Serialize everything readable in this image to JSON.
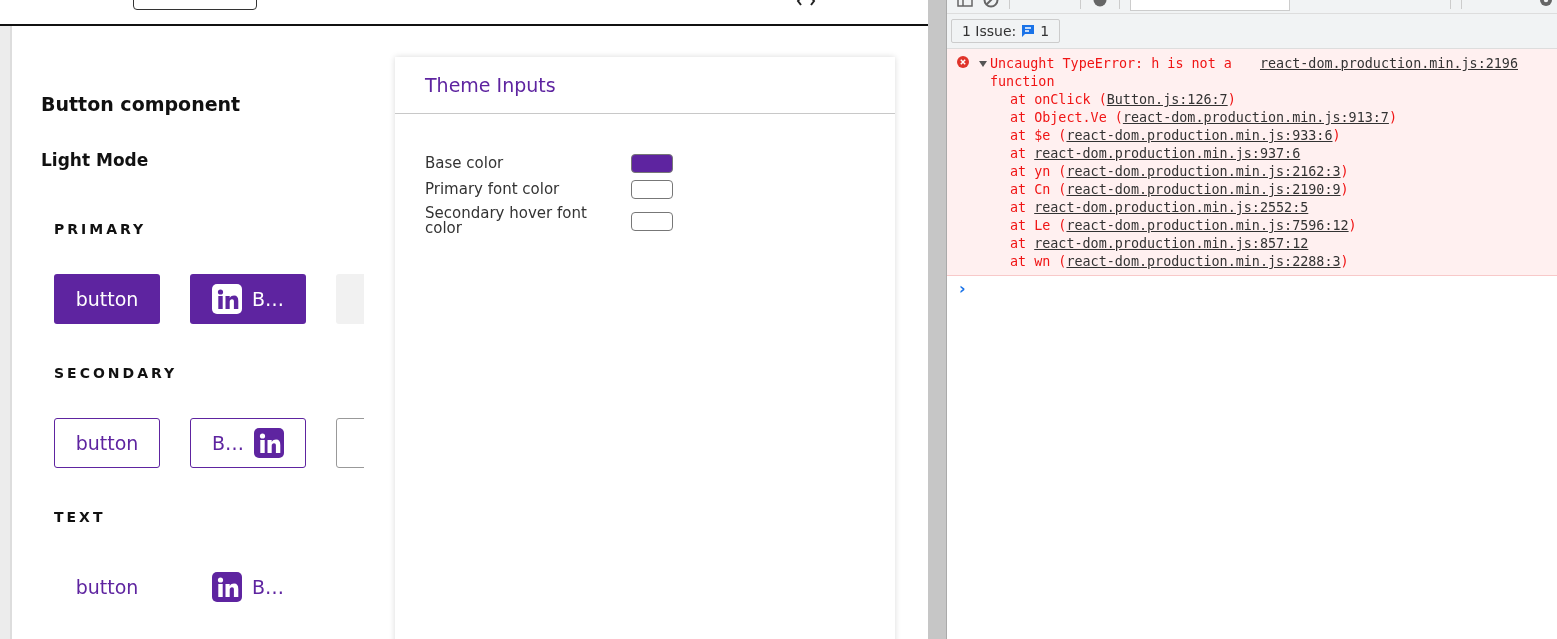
{
  "page": {
    "heading": "Button component",
    "mode": "Light Mode",
    "sections": [
      {
        "title": "PRIMARY",
        "kind": "primary",
        "buttons": [
          {
            "label": "button",
            "kind": "plain",
            "disabled": false
          },
          {
            "label": "B…",
            "kind": "icon-left",
            "disabled": false
          },
          {
            "kind": "plain",
            "disabled": true
          }
        ]
      },
      {
        "title": "SECONDARY",
        "kind": "secondary",
        "buttons": [
          {
            "label": "button",
            "kind": "plain",
            "disabled": false
          },
          {
            "label": "B…",
            "kind": "icon-right",
            "disabled": false
          },
          {
            "kind": "plain",
            "disabled": true
          }
        ]
      },
      {
        "title": "TEXT",
        "kind": "text",
        "buttons": [
          {
            "label": "button",
            "kind": "plain",
            "disabled": false
          },
          {
            "label": "B…",
            "kind": "icon-left",
            "disabled": false
          }
        ]
      }
    ]
  },
  "theme_inputs": {
    "title": "Theme Inputs",
    "fields": [
      {
        "label": "Base color",
        "color": "#5e24a0"
      },
      {
        "label": "Primary font color",
        "color": "#ffffff"
      },
      {
        "label": "Secondary hover font color",
        "color": "#ffffff"
      }
    ]
  },
  "devtools": {
    "issues": {
      "label": "1 Issue:",
      "count": "1"
    },
    "error": {
      "message": "Uncaught TypeError: h is not a function",
      "source": "react-dom.production.min.js:2196",
      "expanded": true,
      "stack": [
        {
          "text": "at onClick (",
          "link": "Button.js:126:7",
          "end": ")"
        },
        {
          "text": "at Object.Ve (",
          "link": "react-dom.production.min.js:913:7",
          "end": ")"
        },
        {
          "text": "at $e (",
          "link": "react-dom.production.min.js:933:6",
          "end": ")"
        },
        {
          "text": "at ",
          "link": "react-dom.production.min.js:937:6"
        },
        {
          "text": "at yn (",
          "link": "react-dom.production.min.js:2162:3",
          "end": ")"
        },
        {
          "text": "at Cn (",
          "link": "react-dom.production.min.js:2190:9",
          "end": ")"
        },
        {
          "text": "at ",
          "link": "react-dom.production.min.js:2552:5"
        },
        {
          "text": "at Le (",
          "link": "react-dom.production.min.js:7596:12",
          "end": ")"
        },
        {
          "text": "at ",
          "link": "react-dom.production.min.js:857:12"
        },
        {
          "text": "at wn (",
          "link": "react-dom.production.min.js:2288:3",
          "end": ")"
        }
      ]
    },
    "prompt": "›"
  }
}
